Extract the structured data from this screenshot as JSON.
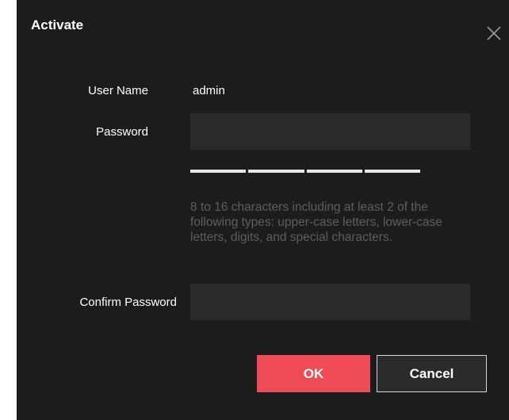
{
  "dialog": {
    "title": "Activate",
    "close_icon": "close-icon"
  },
  "form": {
    "username_label": "User Name",
    "username_value": "admin",
    "password_label": "Password",
    "password_value": "",
    "password_placeholder": "",
    "strength_segments": 4,
    "password_hint": "8 to 16 characters including at least 2 of the following types: upper-case letters, lower-case letters, digits, and special characters.",
    "confirm_label": "Confirm Password",
    "confirm_value": "",
    "confirm_placeholder": ""
  },
  "buttons": {
    "ok_label": "OK",
    "cancel_label": "Cancel"
  },
  "colors": {
    "background": "#1c1c1d",
    "input_bg": "#2a2a2c",
    "primary": "#ef4b57",
    "hint_text": "#5d5d5f"
  }
}
